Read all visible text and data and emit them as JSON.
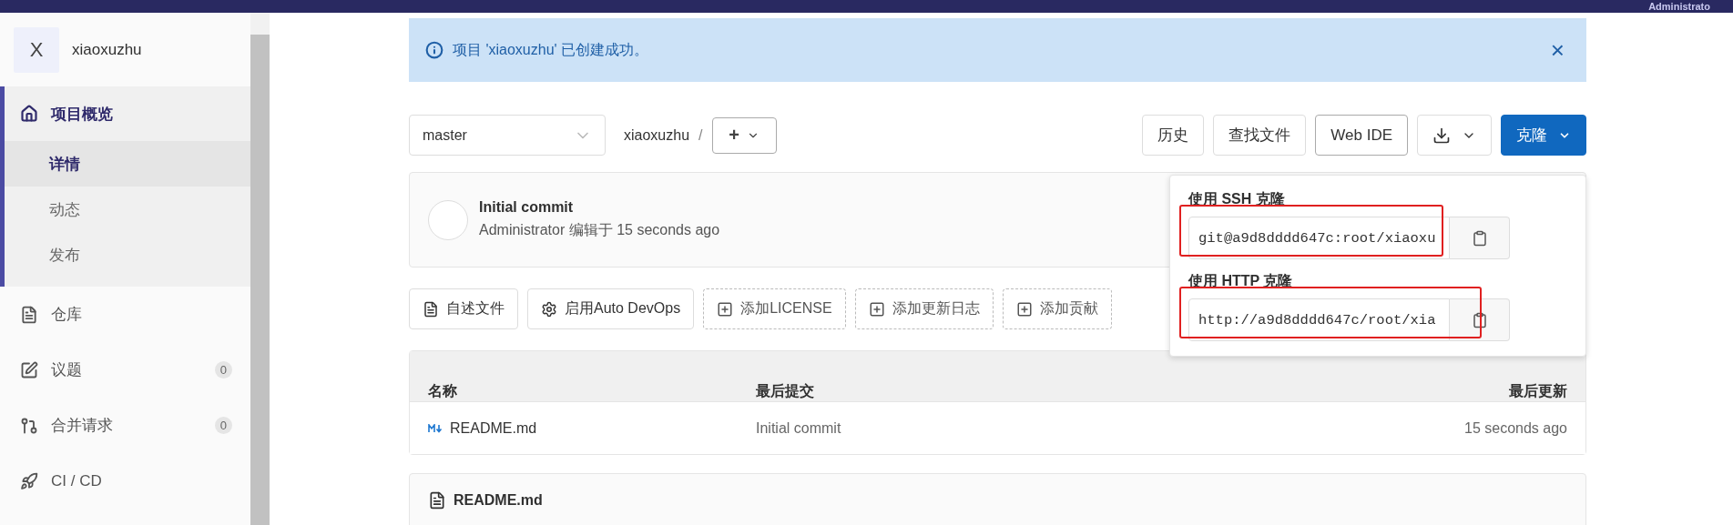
{
  "top_bar": {
    "user": "Administrato"
  },
  "sidebar": {
    "project": {
      "avatar_letter": "X",
      "name": "xiaoxuzhu"
    },
    "items": [
      {
        "label": "项目概览",
        "expanded": true,
        "children": [
          {
            "label": "详情",
            "selected": true
          },
          {
            "label": "动态",
            "selected": false
          },
          {
            "label": "发布",
            "selected": false
          }
        ]
      },
      {
        "label": "仓库",
        "expanded": false
      },
      {
        "label": "议题",
        "expanded": false,
        "count": "0"
      },
      {
        "label": "合并请求",
        "expanded": false,
        "count": "0"
      },
      {
        "label": "CI / CD",
        "expanded": false
      }
    ]
  },
  "alert": {
    "message": "项目 'xiaoxuzhu' 已创建成功。",
    "close": "×"
  },
  "toolbar": {
    "branch": "master",
    "path": "xiaoxuzhu",
    "separator": "/",
    "add": "+",
    "buttons": [
      {
        "kind": "text",
        "label": "历史"
      },
      {
        "kind": "text",
        "label": "查找文件"
      },
      {
        "kind": "outlined",
        "label": "Web IDE"
      },
      {
        "kind": "download"
      },
      {
        "kind": "primary",
        "label": "克隆"
      }
    ]
  },
  "clone_menu": {
    "sections": [
      {
        "label": "使用 SSH 克隆",
        "url": "git@a9d8dddd647c:root/xiaoxu",
        "highlighted": true
      },
      {
        "label": "使用 HTTP 克隆",
        "url": "http://a9d8dddd647c/root/xia",
        "highlighted": true
      }
    ]
  },
  "commit": {
    "title": "Initial commit",
    "author": "Administrator",
    "verb": "编辑于",
    "time": "15 seconds ago"
  },
  "actions": [
    {
      "kind": "solid",
      "label": "自述文件"
    },
    {
      "kind": "solid",
      "label": "启用Auto DevOps"
    },
    {
      "kind": "dashed",
      "label": "添加LICENSE"
    },
    {
      "kind": "dashed",
      "label": "添加更新日志"
    },
    {
      "kind": "dashed",
      "label": "添加贡献"
    }
  ],
  "table": {
    "columns": [
      "名称",
      "最后提交",
      "最后更新"
    ],
    "rows": [
      {
        "name": "README.md",
        "commit": "Initial commit",
        "updated": "15 seconds ago"
      }
    ]
  },
  "readme": {
    "title": "README.md"
  }
}
